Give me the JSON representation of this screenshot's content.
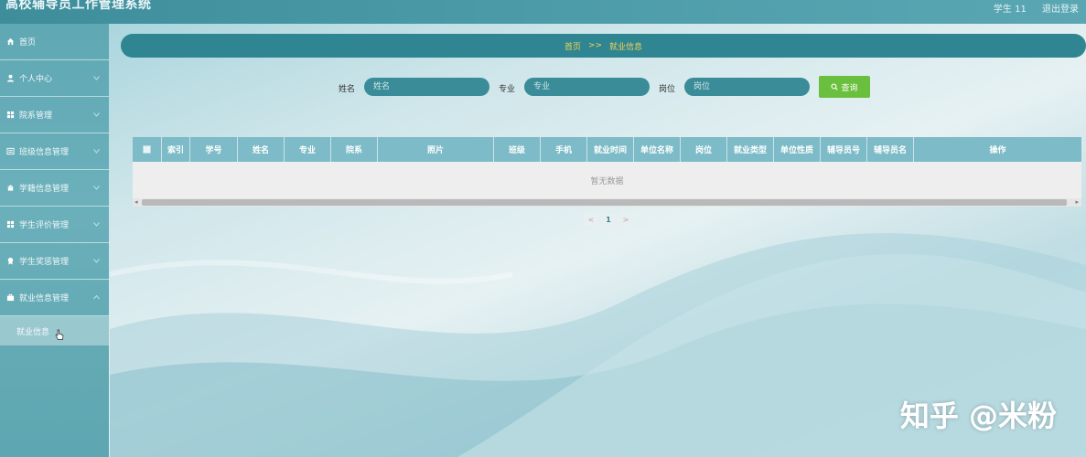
{
  "header": {
    "app_title": "高校辅导员工作管理系统",
    "user_label": "学生 11",
    "logout_label": "退出登录"
  },
  "sidebar": {
    "items": [
      {
        "label": "首页",
        "icon": "home-icon"
      },
      {
        "label": "个人中心",
        "icon": "user-icon"
      },
      {
        "label": "院系管理",
        "icon": "grid-icon"
      },
      {
        "label": "班级信息管理",
        "icon": "list-icon"
      },
      {
        "label": "学籍信息管理",
        "icon": "school-icon"
      },
      {
        "label": "学生评价管理",
        "icon": "grid-icon"
      },
      {
        "label": "学生奖惩管理",
        "icon": "badge-icon"
      },
      {
        "label": "就业信息管理",
        "icon": "briefcase-icon"
      }
    ],
    "submenu": {
      "label": "就业信息"
    }
  },
  "breadcrumb": {
    "home": "首页",
    "sep": ">>",
    "current": "就业信息"
  },
  "search": {
    "name_label": "姓名",
    "name_placeholder": "姓名",
    "major_label": "专业",
    "major_placeholder": "专业",
    "position_label": "岗位",
    "position_placeholder": "岗位",
    "button_label": "查询"
  },
  "table": {
    "columns": [
      "索引",
      "学号",
      "姓名",
      "专业",
      "院系",
      "照片",
      "班级",
      "手机",
      "就业时间",
      "单位名称",
      "岗位",
      "就业类型",
      "单位性质",
      "辅导员号",
      "辅导员名",
      "操作"
    ],
    "empty_text": "暂无数据"
  },
  "pagination": {
    "prev": "<",
    "page": "1",
    "next": ">"
  },
  "watermark": "知乎 @米粉",
  "colors": {
    "accent": "#2f8591",
    "breadcrumb_text": "#f2d357",
    "search_button": "#6bbf3e",
    "table_header": "#7cbbc7"
  }
}
